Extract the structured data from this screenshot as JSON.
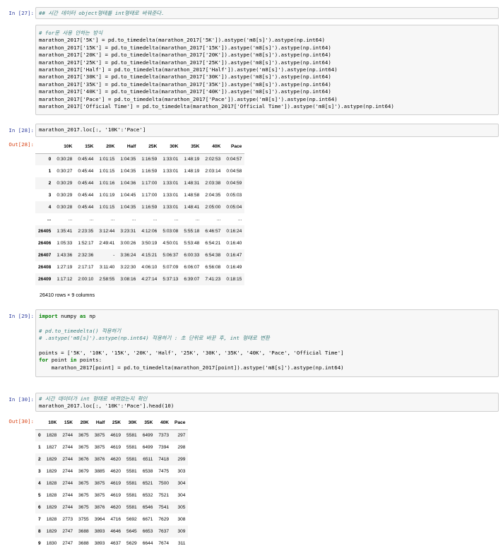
{
  "cells": {
    "c27": {
      "prompt": "In [27]:",
      "comment_top": "## 시간 데이터 object형태를 int형태로 바꿔준다.",
      "lines": [
        "# for문 사용 안하는 방식",
        "marathon_2017['5K'] = pd.to_timedelta(marathon_2017['5K']).astype('m8[s]').astype(np.int64)",
        "marathon_2017['15K'] = pd.to_timedelta(marathon_2017['15K']).astype('m8[s]').astype(np.int64)",
        "marathon_2017['20K'] = pd.to_timedelta(marathon_2017['20K']).astype('m8[s]').astype(np.int64)",
        "marathon_2017['25K'] = pd.to_timedelta(marathon_2017['25K']).astype('m8[s]').astype(np.int64)",
        "marathon_2017['Half'] = pd.to_timedelta(marathon_2017['Half']).astype('m8[s]').astype(np.int64)",
        "marathon_2017['30K'] = pd.to_timedelta(marathon_2017['30K']).astype('m8[s]').astype(np.int64)",
        "marathon_2017['35K'] = pd.to_timedelta(marathon_2017['35K']).astype('m8[s]').astype(np.int64)",
        "marathon_2017['40K'] = pd.to_timedelta(marathon_2017['40K']).astype('m8[s]').astype(np.int64)",
        "marathon_2017['Pace'] = pd.to_timedelta(marathon_2017['Pace']).astype('m8[s]').astype(np.int64)",
        "marathon_2017['Official Time'] = pd.to_timedelta(marathon_2017['Official Time']).astype('m8[s]').astype(np.int64)"
      ]
    },
    "c28": {
      "prompt_in": "In [28]:",
      "prompt_out": "Out[28]:",
      "code": "marathon_2017.loc[:, '10K':'Pace']",
      "columns": [
        "",
        "10K",
        "15K",
        "20K",
        "Half",
        "25K",
        "30K",
        "35K",
        "40K",
        "Pace"
      ],
      "rows": [
        [
          "0",
          "0:30:28",
          "0:45:44",
          "1:01:15",
          "1:04:35",
          "1:16:59",
          "1:33:01",
          "1:48:19",
          "2:02:53",
          "0:04:57"
        ],
        [
          "1",
          "0:30:27",
          "0:45:44",
          "1:01:15",
          "1:04:35",
          "1:16:59",
          "1:33:01",
          "1:48:19",
          "2:03:14",
          "0:04:58"
        ],
        [
          "2",
          "0:30:29",
          "0:45:44",
          "1:01:16",
          "1:04:36",
          "1:17:00",
          "1:33:01",
          "1:48:31",
          "2:03:38",
          "0:04:59"
        ],
        [
          "3",
          "0:30:29",
          "0:45:44",
          "1:01:19",
          "1:04:45",
          "1:17:00",
          "1:33:01",
          "1:48:58",
          "2:04:35",
          "0:05:03"
        ],
        [
          "4",
          "0:30:28",
          "0:45:44",
          "1:01:15",
          "1:04:35",
          "1:16:59",
          "1:33:01",
          "1:48:41",
          "2:05:00",
          "0:05:04"
        ],
        [
          "...",
          "...",
          "...",
          "...",
          "...",
          "...",
          "...",
          "...",
          "...",
          "..."
        ],
        [
          "26405",
          "1:35:41",
          "2:23:35",
          "3:12:44",
          "3:23:31",
          "4:12:06",
          "5:03:08",
          "5:55:18",
          "6:46:57",
          "0:16:24"
        ],
        [
          "26406",
          "1:05:33",
          "1:52:17",
          "2:49:41",
          "3:00:26",
          "3:50:19",
          "4:50:01",
          "5:53:48",
          "6:54:21",
          "0:16:40"
        ],
        [
          "26407",
          "1:43:36",
          "2:32:36",
          "-",
          "3:36:24",
          "4:15:21",
          "5:06:37",
          "6:00:33",
          "6:54:38",
          "0:16:47"
        ],
        [
          "26408",
          "1:27:19",
          "2:17:17",
          "3:11:40",
          "3:22:30",
          "4:06:10",
          "5:07:09",
          "6:06:07",
          "6:56:08",
          "0:16:49"
        ],
        [
          "26409",
          "1:17:12",
          "2:00:10",
          "2:58:55",
          "3:08:16",
          "4:27:14",
          "5:37:13",
          "6:39:07",
          "7:41:23",
          "0:18:15"
        ]
      ],
      "shape_text": "26410 rows × 9 columns"
    },
    "c29": {
      "prompt": "In [29]:",
      "import_kw": "import",
      "import_mod": " numpy ",
      "import_as": "as",
      "import_alias": " np",
      "comment1": "# pd.to_timedelta() 적용하기",
      "comment2": "# .astype('m8[s]').astype(np.int64) 적용하기 : 초 단위로 바꾼 후, int 형태로 변환",
      "points_line": "points = ['5K', '10K', '15K', '20K', 'Half', '25K', '30K', '35K', '40K', 'Pace', 'Official Time']",
      "for_kw": "for",
      "for_var": " point ",
      "in_kw": "in",
      "for_rest": " points:",
      "body_line": "    marathon_2017[point] = pd.to_timedelta(marathon_2017[point]).astype('m8[s]').astype(np.int64)"
    },
    "c30": {
      "prompt_in": "In [30]:",
      "prompt_out": "Out[30]:",
      "comment": "# 시간 데이터가 int 형태로 바뀌었는지 확인",
      "code": "marathon_2017.loc[:, '10K':'Pace'].head(10)",
      "columns": [
        "",
        "10K",
        "15K",
        "20K",
        "Half",
        "25K",
        "30K",
        "35K",
        "40K",
        "Pace"
      ],
      "rows": [
        [
          "0",
          "1828",
          "2744",
          "3675",
          "3875",
          "4619",
          "5581",
          "6499",
          "7373",
          "297"
        ],
        [
          "1",
          "1827",
          "2744",
          "3675",
          "3875",
          "4619",
          "5581",
          "6499",
          "7394",
          "298"
        ],
        [
          "2",
          "1829",
          "2744",
          "3676",
          "3876",
          "4620",
          "5581",
          "6511",
          "7418",
          "299"
        ],
        [
          "3",
          "1829",
          "2744",
          "3679",
          "3885",
          "4620",
          "5581",
          "6538",
          "7475",
          "303"
        ],
        [
          "4",
          "1828",
          "2744",
          "3675",
          "3875",
          "4619",
          "5581",
          "6521",
          "7500",
          "304"
        ],
        [
          "5",
          "1828",
          "2744",
          "3675",
          "3875",
          "4619",
          "5581",
          "6532",
          "7521",
          "304"
        ],
        [
          "6",
          "1829",
          "2744",
          "3675",
          "3876",
          "4620",
          "5581",
          "6546",
          "7541",
          "305"
        ],
        [
          "7",
          "1828",
          "2773",
          "3755",
          "3964",
          "4716",
          "5692",
          "6671",
          "7629",
          "308"
        ],
        [
          "8",
          "1829",
          "2747",
          "3688",
          "3893",
          "4646",
          "5645",
          "6653",
          "7637",
          "309"
        ],
        [
          "9",
          "1830",
          "2747",
          "3688",
          "3893",
          "4637",
          "5629",
          "6644",
          "7674",
          "311"
        ]
      ]
    }
  }
}
